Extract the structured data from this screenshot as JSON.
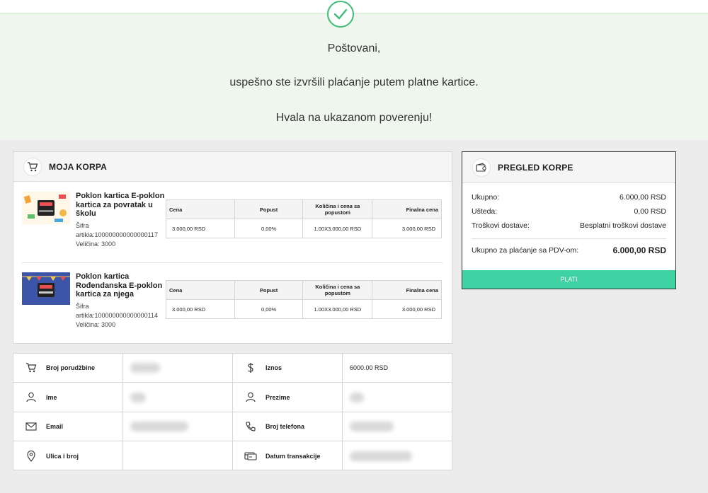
{
  "message": {
    "line1": "Poštovani,",
    "line2": "uspešno ste izvršili plaćanje putem platne kartice.",
    "line3": "Hvala na ukazanom poverenju!"
  },
  "cart": {
    "title": "MOJA KORPA",
    "columns": [
      "Cena",
      "Popust",
      "Količina i cena sa popustom",
      "Finalna cena"
    ],
    "products": [
      {
        "name": "Poklon kartica E-poklon kartica za povratak u školu",
        "sku_label": "Šifra artikla:",
        "sku": "100000000000000117",
        "size_label": "Veličina:",
        "size": "3000",
        "price": "3.000,00 RSD",
        "discount": "0,00%",
        "qty_price": "1.00X3.000,00 RSD",
        "final": "3.000,00 RSD"
      },
      {
        "name": "Poklon kartica Rođendanska E-poklon kartica za njega",
        "sku_label": "Šifra artikla:",
        "sku": "100000000000000114",
        "size_label": "Veličina:",
        "size": "3000",
        "price": "3.000,00 RSD",
        "discount": "0,00%",
        "qty_price": "1.00X3.000,00 RSD",
        "final": "3.000,00 RSD"
      }
    ]
  },
  "summary": {
    "title": "PREGLED KORPE",
    "total_label": "Ukupno:",
    "total": "6.000,00 RSD",
    "saving_label": "Ušteda:",
    "saving": "0,00 RSD",
    "shipping_label": "Troškovi dostave:",
    "shipping": "Besplatni troškovi dostave",
    "grand_label": "Ukupno za plaćanje sa PDV-om:",
    "grand": "6.000,00 RSD",
    "pay_label": "PLATI"
  },
  "order": {
    "order_no_label": "Broj porudžbine",
    "amount_label": "Iznos",
    "amount": "6000.00 RSD",
    "first_name_label": "Ime",
    "last_name_label": "Prezime",
    "email_label": "Email",
    "phone_label": "Broj telefona",
    "street_label": "Ulica i broj",
    "date_label": "Datum transakcije"
  },
  "colors": {
    "accent": "#3fd3a3",
    "check": "#3dbd74",
    "hero_bg": "#eff6ee"
  }
}
